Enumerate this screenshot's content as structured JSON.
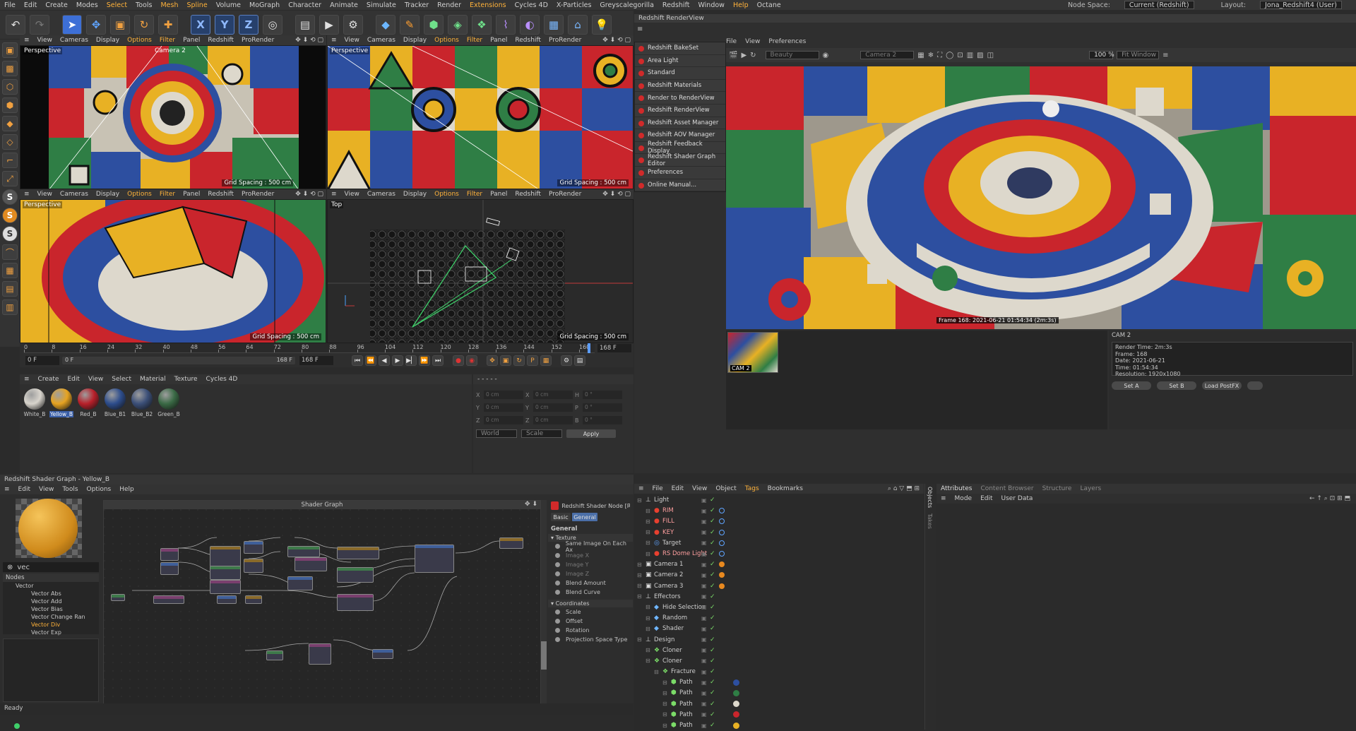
{
  "menu": {
    "items": [
      "File",
      "Edit",
      "Create",
      "Modes",
      "Select",
      "Tools",
      "Mesh",
      "Spline",
      "Volume",
      "MoGraph",
      "Character",
      "Animate",
      "Simulate",
      "Tracker",
      "Render",
      "Extensions",
      "Cycles 4D",
      "X-Particles",
      "Greyscalegorilla",
      "Redshift",
      "Window",
      "Help",
      "Octane"
    ],
    "node_space_label": "Node Space:",
    "node_space_value": "Current (Redshift)",
    "layout_label": "Layout:",
    "layout_value": "Jona_Redshift4 (User)"
  },
  "toolbar": {
    "icons": [
      "undo-icon",
      "redo-icon",
      "select-icon",
      "move-icon",
      "scale-icon",
      "rotate-icon",
      "add-icon",
      "x-axis-icon",
      "y-axis-icon",
      "z-axis-icon",
      "world-icon",
      "render-region-icon",
      "render-view-icon",
      "render-settings-icon",
      "cube-icon",
      "pen-icon",
      "generator-icon",
      "subdivision-icon",
      "cloner-icon",
      "deformer-icon",
      "field-icon",
      "floor-icon",
      "camera-icon",
      "light-icon"
    ],
    "xyz": [
      "X",
      "Y",
      "Z"
    ]
  },
  "viewport_menu": [
    "View",
    "Cameras",
    "Display",
    "Options",
    "Filter",
    "Panel",
    "Redshift",
    "ProRender"
  ],
  "viewports": {
    "tl": {
      "label": "Perspective",
      "camera": "Camera 2",
      "grid": "Grid Spacing : 500 cm"
    },
    "tr": {
      "label": "Perspective",
      "grid": "Grid Spacing : 500 cm"
    },
    "bl": {
      "label": "Perspective",
      "grid": "Grid Spacing : 500 cm"
    },
    "br": {
      "label": "Top",
      "grid": "Grid Spacing : 500 cm"
    }
  },
  "timeline": {
    "ticks": [
      "0",
      "8",
      "16",
      "24",
      "32",
      "40",
      "48",
      "56",
      "64",
      "72",
      "80",
      "88",
      "96",
      "104",
      "112",
      "120",
      "128",
      "136",
      "144",
      "152",
      "160"
    ],
    "current_frame": "168 F",
    "start": "0 F",
    "start2": "0 F",
    "end": "168 F",
    "end2": "168 F"
  },
  "material_manager": {
    "menu": [
      "Create",
      "Edit",
      "View",
      "Select",
      "Material",
      "Texture",
      "Cycles 4D"
    ],
    "materials": [
      {
        "name": "White_B",
        "color": "#d8d4cc"
      },
      {
        "name": "Yellow_B",
        "color": "#e6a321"
      },
      {
        "name": "Red_B",
        "color": "#b8202a"
      },
      {
        "name": "Blue_B1",
        "color": "#2d4d8c"
      },
      {
        "name": "Blue_B2",
        "color": "#3b4f78"
      },
      {
        "name": "Green_B",
        "color": "#3a6a45"
      }
    ]
  },
  "coordinates": {
    "rows": [
      [
        "X",
        "0 cm",
        "X",
        "0 cm",
        "H",
        "0 °"
      ],
      [
        "Y",
        "0 cm",
        "Y",
        "0 cm",
        "P",
        "0 °"
      ],
      [
        "Z",
        "0 cm",
        "Z",
        "0 cm",
        "B",
        "0 °"
      ]
    ],
    "world": "World",
    "scale": "Scale",
    "apply": "Apply"
  },
  "renderview": {
    "title": "Redshift RenderView",
    "menu": [
      "File",
      "View",
      "Preferences"
    ],
    "aov": "Beauty",
    "camera": "Camera 2",
    "zoom": "100 %",
    "fit": "Fit Window",
    "caption": "Frame  168:  2021-06-21  01:54:34  (2m:3s)",
    "cam_label": "CAM 2",
    "thumb_label": "CAM 2",
    "info": [
      "Render Time: 2m:3s",
      "Frame: 168",
      "Date: 2021-06-21",
      "Time: 01:54:34",
      "Resolution: 1920x1080"
    ],
    "buttons": [
      "Set A",
      "Set B",
      "Load PostFX"
    ]
  },
  "redshift_menu": [
    "Redshift BakeSet",
    "Area Light",
    "Standard",
    "Redshift Materials",
    "Render to RenderView",
    "Redshift RenderView",
    "Redshift Asset Manager",
    "Redshift AOV Manager",
    "Redshift Feedback Display",
    "Redshift Shader Graph Editor",
    "Preferences",
    "Online Manual..."
  ],
  "shader_graph": {
    "title": "Redshift Shader Graph - Yellow_B",
    "menu": [
      "Edit",
      "View",
      "Tools",
      "Options",
      "Help"
    ],
    "canvas_title": "Shader Graph",
    "search": "vec",
    "nodes_header": "Nodes",
    "tree": [
      "Vector",
      "Vector Abs",
      "Vector Add",
      "Vector Bias",
      "Vector Change Ran",
      "Vector Div",
      "Vector Exp"
    ],
    "node_panel_title": "Redshift Shader Node [RS",
    "tabs": [
      "Basic",
      "General"
    ],
    "section": "General",
    "texture_group": "Texture",
    "texture_rows": [
      "Same Image On Each Ax",
      "Image X",
      "Image Y",
      "Image Z",
      "Blend Amount",
      "Blend Curve"
    ],
    "coord_group": "Coordinates",
    "coord_rows": [
      "Scale",
      "Offset",
      "Rotation",
      "Projection Space Type"
    ]
  },
  "object_manager": {
    "menu": [
      "File",
      "Edit",
      "View",
      "Object",
      "Tags",
      "Bookmarks"
    ],
    "side_tabs": [
      "Objects",
      "Takes"
    ],
    "objects": [
      {
        "name": "Light",
        "depth": 0,
        "kind": "null"
      },
      {
        "name": "RIM",
        "depth": 1,
        "kind": "light"
      },
      {
        "name": "FILL",
        "depth": 1,
        "kind": "light"
      },
      {
        "name": "KEY",
        "depth": 1,
        "kind": "light"
      },
      {
        "name": "Target",
        "depth": 1,
        "kind": "target"
      },
      {
        "name": "RS Dome Light",
        "depth": 1,
        "kind": "light"
      },
      {
        "name": "Camera 1",
        "depth": 0,
        "kind": "camera"
      },
      {
        "name": "Camera 2",
        "depth": 0,
        "kind": "camera"
      },
      {
        "name": "Camera 3",
        "depth": 0,
        "kind": "camera"
      },
      {
        "name": "Effectors",
        "depth": 0,
        "kind": "null"
      },
      {
        "name": "Hide Selection",
        "depth": 1,
        "kind": "effector"
      },
      {
        "name": "Random",
        "depth": 1,
        "kind": "effector"
      },
      {
        "name": "Shader",
        "depth": 1,
        "kind": "effector"
      },
      {
        "name": "Design",
        "depth": 0,
        "kind": "null"
      },
      {
        "name": "Cloner",
        "depth": 1,
        "kind": "cloner"
      },
      {
        "name": "Cloner",
        "depth": 1,
        "kind": "cloner"
      },
      {
        "name": "Fracture",
        "depth": 2,
        "kind": "cloner"
      },
      {
        "name": "Path",
        "depth": 3,
        "kind": "path"
      },
      {
        "name": "Path",
        "depth": 3,
        "kind": "path"
      },
      {
        "name": "Path",
        "depth": 3,
        "kind": "path"
      },
      {
        "name": "Path",
        "depth": 3,
        "kind": "path"
      },
      {
        "name": "Path",
        "depth": 3,
        "kind": "path"
      }
    ]
  },
  "attributes": {
    "tabs": [
      "Attributes",
      "Content Browser",
      "Structure",
      "Layers"
    ],
    "menu": [
      "Mode",
      "Edit",
      "User Data"
    ]
  },
  "status": {
    "text": "Ready"
  }
}
